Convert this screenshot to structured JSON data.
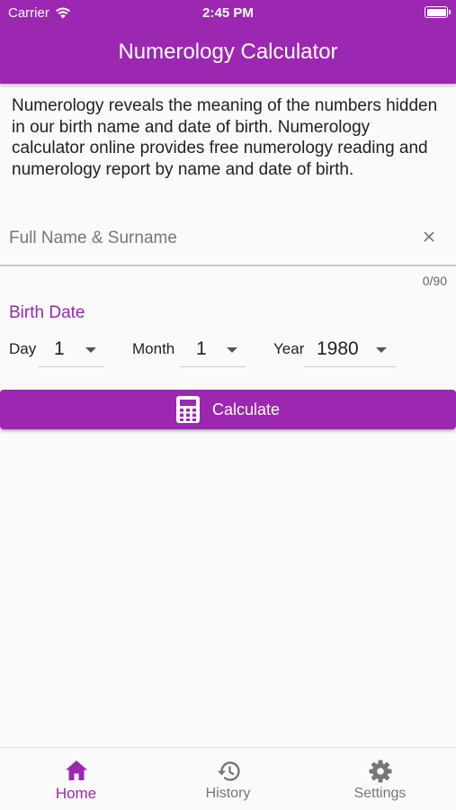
{
  "status_bar": {
    "carrier": "Carrier",
    "time": "2:45 PM"
  },
  "app_bar": {
    "title": "Numerology Calculator"
  },
  "intro": {
    "text": "Numerology reveals the meaning of the numbers hidden in our birth name and date of birth. Numerology calculator online provides free numerology reading and numerology report by name and date of birth."
  },
  "name_field": {
    "placeholder": "Full Name & Surname",
    "value": "",
    "counter": "0/90"
  },
  "birth_date": {
    "label": "Birth Date",
    "day": {
      "label": "Day",
      "value": "1"
    },
    "month": {
      "label": "Month",
      "value": "1"
    },
    "year": {
      "label": "Year",
      "value": "1980"
    }
  },
  "calculate_button": {
    "label": "Calculate"
  },
  "bottom_nav": {
    "items": [
      {
        "label": "Home",
        "icon": "home-icon",
        "active": true
      },
      {
        "label": "History",
        "icon": "history-icon",
        "active": false
      },
      {
        "label": "Settings",
        "icon": "gear-icon",
        "active": false
      }
    ]
  },
  "colors": {
    "primary": "#9c27b0",
    "background": "#fafafa",
    "inactive": "#777777"
  }
}
